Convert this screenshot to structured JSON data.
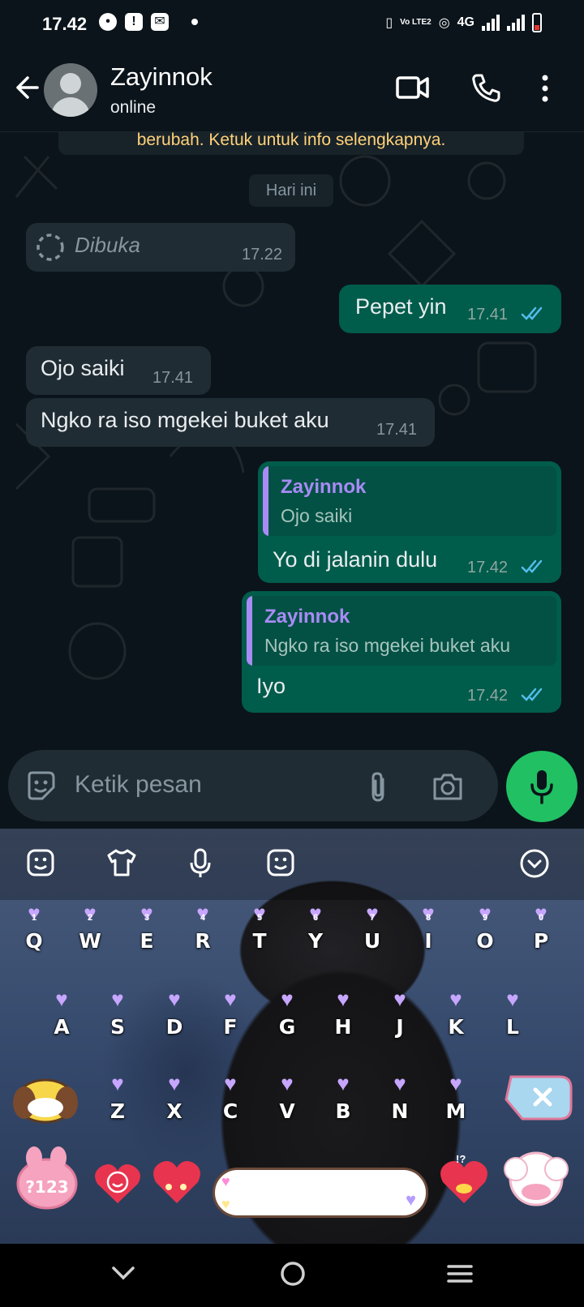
{
  "status_bar": {
    "time": "17.42",
    "network": "4G",
    "volte": "Vo LTE2"
  },
  "header": {
    "contact_name": "Zayinnok",
    "contact_status": "online"
  },
  "chat": {
    "system_note": "berubah. Ketuk untuk info selengkapnya.",
    "date_chip": "Hari ini",
    "messages": [
      {
        "type": "view_once",
        "direction": "in",
        "text": "Dibuka",
        "time": "17.22"
      },
      {
        "direction": "out",
        "text": "Pepet yin",
        "time": "17.41",
        "read": true
      },
      {
        "direction": "in",
        "text": "Ojo saiki",
        "time": "17.41"
      },
      {
        "direction": "in",
        "text": "Ngko ra iso mgekei buket aku",
        "time": "17.41"
      },
      {
        "direction": "out",
        "quote_name": "Zayinnok",
        "quote_text": "Ojo saiki",
        "text": "Yo di jalanin dulu",
        "time": "17.42",
        "read": true
      },
      {
        "direction": "out",
        "quote_name": "Zayinnok",
        "quote_text": "Ngko ra iso mgekei buket aku",
        "text": "Iyo",
        "time": "17.42",
        "read": true
      }
    ]
  },
  "composer": {
    "placeholder": "Ketik pesan"
  },
  "keyboard": {
    "row1": [
      {
        "letter": "Q",
        "num": "1"
      },
      {
        "letter": "W",
        "num": "2"
      },
      {
        "letter": "E",
        "num": "3"
      },
      {
        "letter": "R",
        "num": "4"
      },
      {
        "letter": "T",
        "num": "5"
      },
      {
        "letter": "Y",
        "num": "6"
      },
      {
        "letter": "U",
        "num": "7"
      },
      {
        "letter": "I",
        "num": "8"
      },
      {
        "letter": "O",
        "num": "9"
      },
      {
        "letter": "P",
        "num": "0"
      }
    ],
    "row2": [
      "A",
      "S",
      "D",
      "F",
      "G",
      "H",
      "J",
      "K",
      "L"
    ],
    "row3": [
      "Z",
      "X",
      "C",
      "V",
      "B",
      "N",
      "M"
    ],
    "symbols_key": "?123",
    "punct_key": "!?"
  },
  "colors": {
    "accent_green": "#21c063",
    "outgoing_bubble": "#005c4b",
    "incoming_bubble": "#202c33",
    "quote_name": "#a88bf5",
    "read_ticks": "#53bdeb"
  }
}
